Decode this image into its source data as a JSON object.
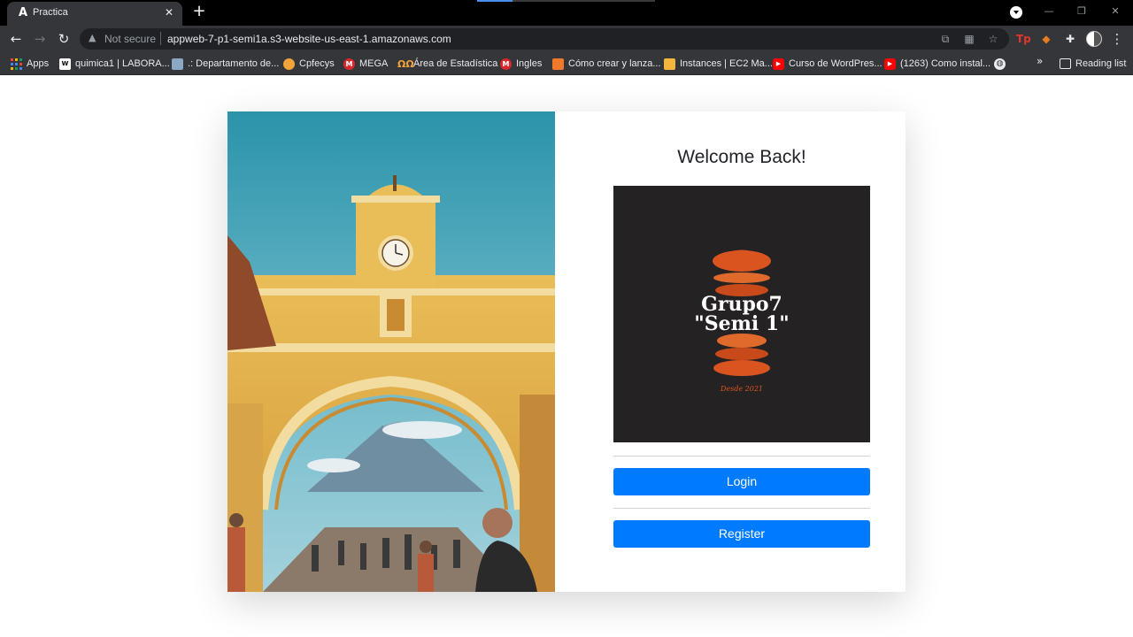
{
  "browser": {
    "tab_title": "Practica",
    "tab_favicon": "A",
    "security_label": "Not secure",
    "url": "appweb-7-p1-semi1a.s3-website-us-east-1.amazonaws.com",
    "bookmarks": [
      {
        "label": "Apps",
        "icon": "apps-grid-icon"
      },
      {
        "label": "quimica1 | LABORA...",
        "icon": "wix-icon"
      },
      {
        "label": ".: Departamento de...",
        "icon": "departamento-icon"
      },
      {
        "label": "Cpfecys",
        "icon": "cpfecys-icon"
      },
      {
        "label": "MEGA",
        "icon": "mega-icon"
      },
      {
        "label": "Área de Estadística",
        "icon": "estadistica-icon"
      },
      {
        "label": "Ingles",
        "icon": "mega-icon"
      },
      {
        "label": "Cómo crear y lanza...",
        "icon": "aws-cube-icon"
      },
      {
        "label": "Instances | EC2 Ma...",
        "icon": "aws-box-icon"
      },
      {
        "label": "Curso de WordPres...",
        "icon": "youtube-icon"
      },
      {
        "label": "(1263) Como instal...",
        "icon": "youtube-icon"
      }
    ],
    "reading_list": "Reading list"
  },
  "page": {
    "welcome": "Welcome Back!",
    "logo": {
      "line1": "Grupo7",
      "line2": "\"Semi 1\"",
      "tagline": "Desde 2021"
    },
    "login_label": "Login",
    "register_label": "Register"
  },
  "colors": {
    "primary_button": "#007bff",
    "logo_bg": "#252223",
    "logo_accent": "#d9541f"
  }
}
